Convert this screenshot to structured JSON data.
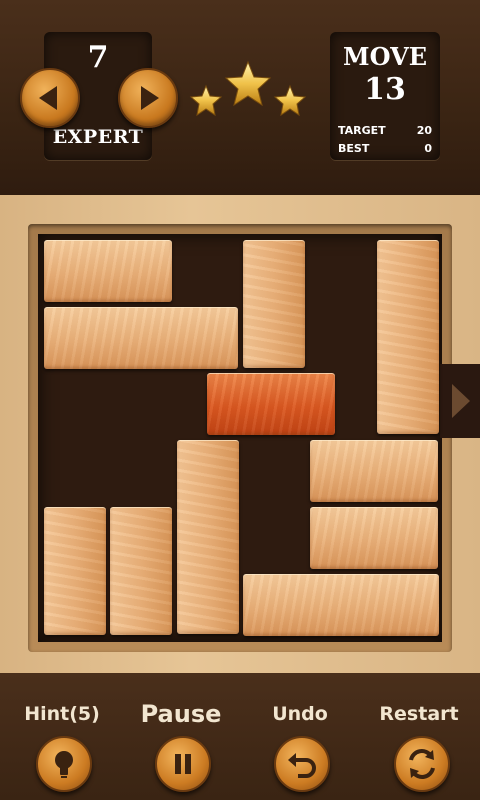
{
  "level": {
    "number": "7",
    "difficulty": "EXPERT"
  },
  "stars": {
    "count": 3
  },
  "moves": {
    "label": "MOVE",
    "value": "13",
    "target_label": "TARGET",
    "target": "20",
    "best_label": "BEST",
    "best": "0"
  },
  "controls": {
    "hint": "Hint(5)",
    "pause": "Pause",
    "undo": "Undo",
    "restart": "Restart"
  },
  "icons": {
    "prev": "arrow-left-icon",
    "next": "arrow-right-icon",
    "hint": "lightbulb-icon",
    "pause": "pause-icon",
    "undo": "undo-icon",
    "restart": "restart-icon",
    "exit": "exit-arrow-icon"
  },
  "colors": {
    "accent": "#d58a2e",
    "target_block": "#dc5a22",
    "wood_block": "#ebb37c",
    "board": "#2e1b10"
  }
}
